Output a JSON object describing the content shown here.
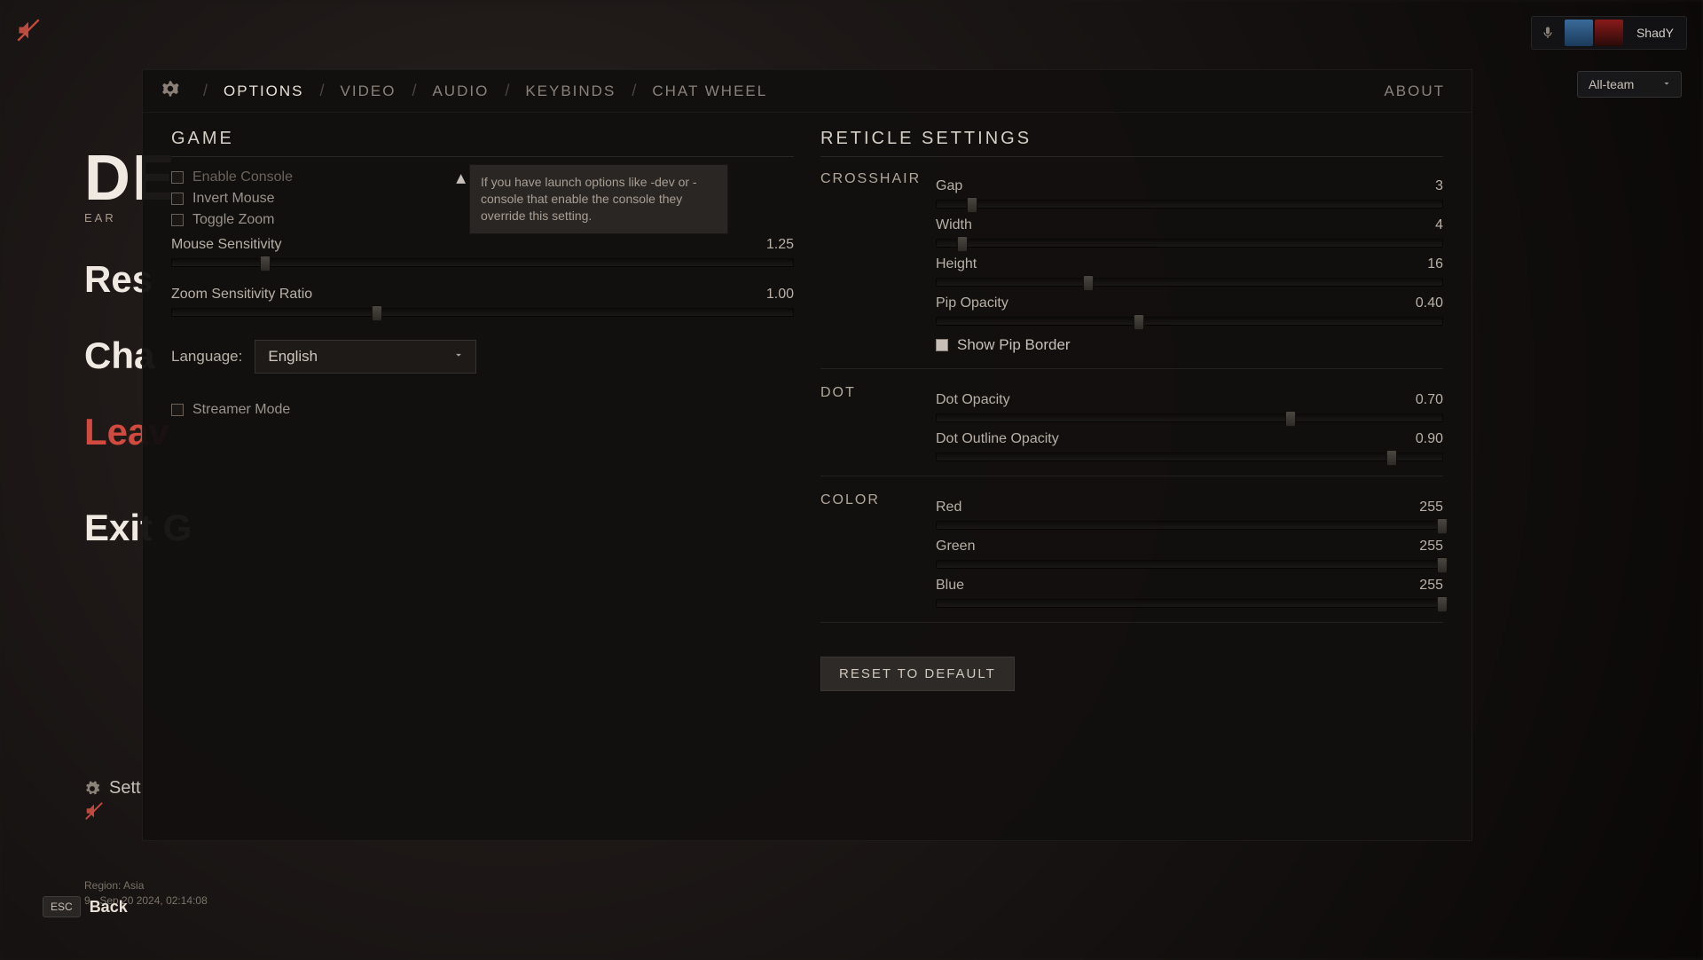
{
  "player": {
    "name": "ShadY"
  },
  "team_select": {
    "value": "All-team"
  },
  "tabs": {
    "options": "OPTIONS",
    "video": "VIDEO",
    "audio": "AUDIO",
    "keybinds": "KEYBINDS",
    "chat_wheel": "CHAT WHEEL",
    "about": "ABOUT"
  },
  "pause": {
    "title": "DE",
    "sub": "EAR",
    "resume": "Res",
    "change": "Cha",
    "leave": "Leav",
    "exit": "Exit G",
    "settings": "Sett"
  },
  "game": {
    "section": "GAME",
    "enable_console": "Enable Console",
    "invert_mouse": "Invert Mouse",
    "toggle_zoom": "Toggle Zoom",
    "tooltip": "If you have launch options like -dev or -console that enable the console they override this setting.",
    "mouse_sens_label": "Mouse Sensitivity",
    "mouse_sens_value": "1.25",
    "mouse_sens_pct": 15,
    "zoom_sens_label": "Zoom Sensitivity Ratio",
    "zoom_sens_value": "1.00",
    "zoom_sens_pct": 33,
    "language_label": "Language:",
    "language_value": "English",
    "streamer_mode": "Streamer Mode"
  },
  "reticle": {
    "section": "RETICLE SETTINGS",
    "crosshair_label": "CROSSHAIR",
    "dot_label": "DOT",
    "color_label": "COLOR",
    "gap": {
      "label": "Gap",
      "value": "3",
      "pct": 7
    },
    "width": {
      "label": "Width",
      "value": "4",
      "pct": 5
    },
    "height": {
      "label": "Height",
      "value": "16",
      "pct": 30
    },
    "pip": {
      "label": "Pip Opacity",
      "value": "0.40",
      "pct": 40
    },
    "show_pip": "Show Pip Border",
    "dot_op": {
      "label": "Dot Opacity",
      "value": "0.70",
      "pct": 70
    },
    "dot_out": {
      "label": "Dot Outline Opacity",
      "value": "0.90",
      "pct": 90
    },
    "red": {
      "label": "Red",
      "value": "255",
      "pct": 100
    },
    "green": {
      "label": "Green",
      "value": "255",
      "pct": 100
    },
    "blue": {
      "label": "Blue",
      "value": "255",
      "pct": 100
    },
    "reset": "RESET TO DEFAULT"
  },
  "footer": {
    "region_label": "Region:",
    "region_value": "Asia",
    "build": "9 - Sep 20 2024, 02:14:08",
    "esc": "ESC",
    "back": "Back"
  }
}
